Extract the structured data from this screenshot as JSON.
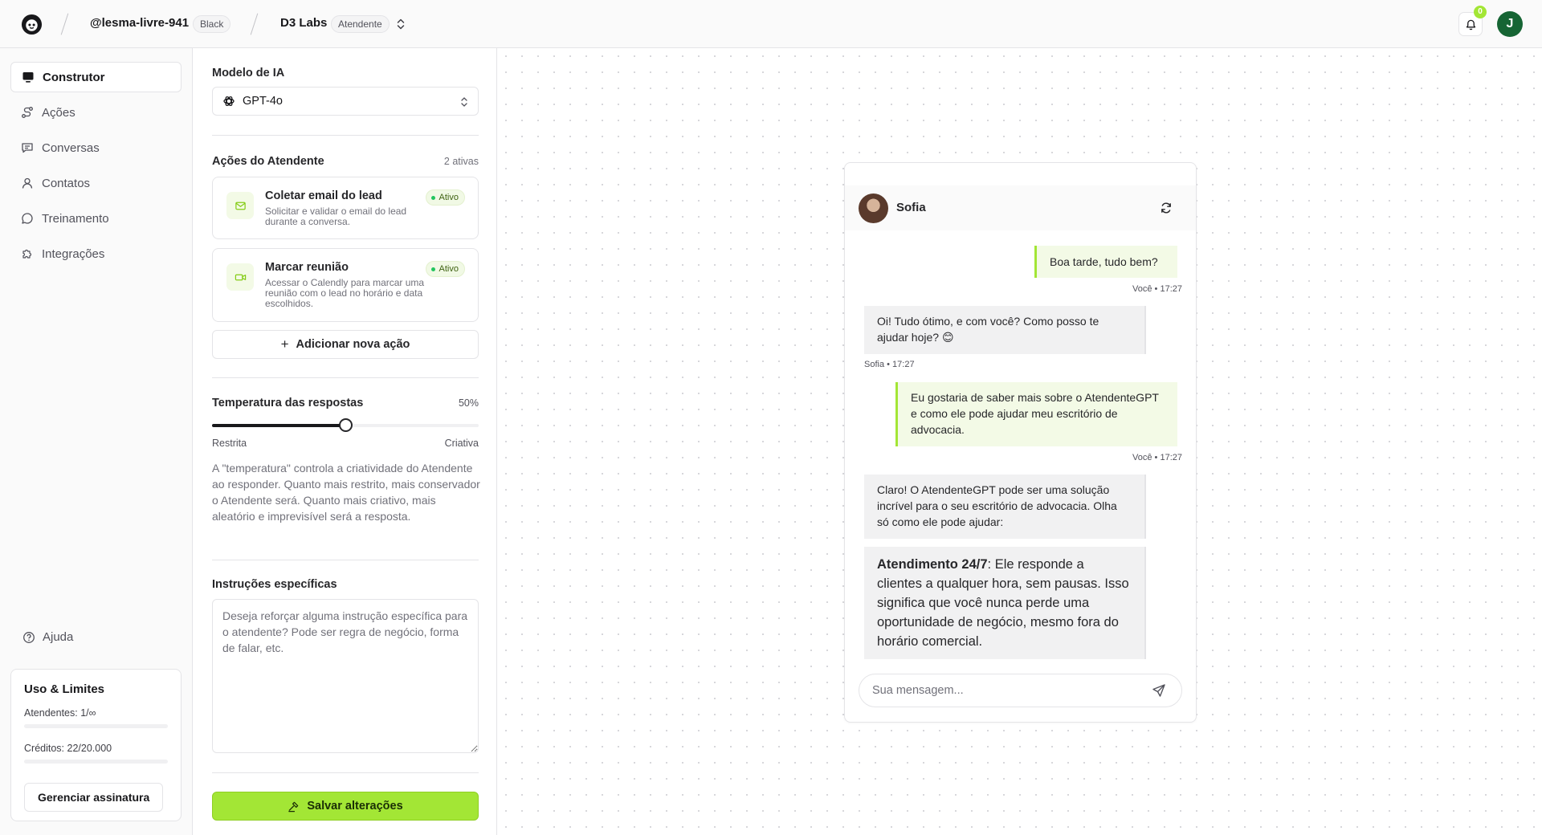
{
  "topbar": {
    "user_handle": "@lesma-livre-941",
    "plan_badge": "Black",
    "org_name": "D3 Labs",
    "org_role": "Atendente",
    "notification_count": "0",
    "avatar_initial": "J"
  },
  "sidebar": {
    "items": [
      {
        "label": "Construtor",
        "icon": "monitor-icon"
      },
      {
        "label": "Ações",
        "icon": "route-icon"
      },
      {
        "label": "Conversas",
        "icon": "message-square-icon"
      },
      {
        "label": "Contatos",
        "icon": "user-icon"
      },
      {
        "label": "Treinamento",
        "icon": "message-circle-icon"
      },
      {
        "label": "Integrações",
        "icon": "puzzle-icon"
      }
    ],
    "help_label": "Ajuda",
    "usage": {
      "title": "Uso & Limites",
      "attendants": "Atendentes: 1/∞",
      "credits": "Créditos: 22/20.000",
      "manage_label": "Gerenciar assinatura"
    }
  },
  "builder": {
    "model_label": "Modelo de IA",
    "model_value": "GPT-4o",
    "actions_label": "Ações do Atendente",
    "actions_count": "2 ativas",
    "actions": [
      {
        "title": "Coletar email do lead",
        "desc": "Solicitar e validar o email do lead durante a conversa.",
        "status": "Ativo",
        "icon": "mail-icon"
      },
      {
        "title": "Marcar reunião",
        "desc": "Acessar o Calendly para marcar uma reunião com o lead no horário e data escolhidos.",
        "status": "Ativo",
        "icon": "video-icon"
      }
    ],
    "add_action_label": "Adicionar nova ação",
    "temperature_label": "Temperatura das respostas",
    "temperature_value": "50%",
    "temperature_level": 0.5,
    "slider_min": "Restrita",
    "slider_max": "Criativa",
    "temperature_help": "A \"temperatura\" controla a criatividade do Atendente ao responder. Quanto mais restrito, mais conservador o Atendente será. Quanto mais criativo, mais aleatório e imprevisível será a resposta.",
    "instructions_label": "Instruções específicas",
    "instructions_placeholder": "Deseja reforçar alguma instrução específica para o atendente? Pode ser regra de negócio, forma de falar, etc.",
    "save_label": "Salvar alterações"
  },
  "chat": {
    "bot_name": "Sofia",
    "messages": [
      {
        "from": "user",
        "text": "Boa tarde, tudo bem?",
        "meta": "Você • 17:27"
      },
      {
        "from": "bot",
        "text": "Oi! Tudo ótimo, e com você? Como posso te ajudar hoje? 😊",
        "meta": "Sofia • 17:27"
      },
      {
        "from": "user",
        "text": "Eu gostaria de saber mais sobre o AtendenteGPT e como ele pode ajudar meu escritório de advocacia.",
        "meta": "Você • 17:27"
      },
      {
        "from": "bot",
        "text": "Claro! O AtendenteGPT pode ser uma solução incrível para o seu escritório de advocacia. Olha só como ele pode ajudar:"
      },
      {
        "from": "bot",
        "bold": "Atendimento 24/7",
        "text": ": Ele responde a clientes a qualquer hora, sem pausas. Isso significa que você nunca perde uma oportunidade de negócio, mesmo fora do horário comercial."
      }
    ],
    "input_placeholder": "Sua mensagem..."
  },
  "colors": {
    "accent": "#a3e635",
    "avatar_bg": "#166534",
    "active_dot": "#22c55e"
  }
}
